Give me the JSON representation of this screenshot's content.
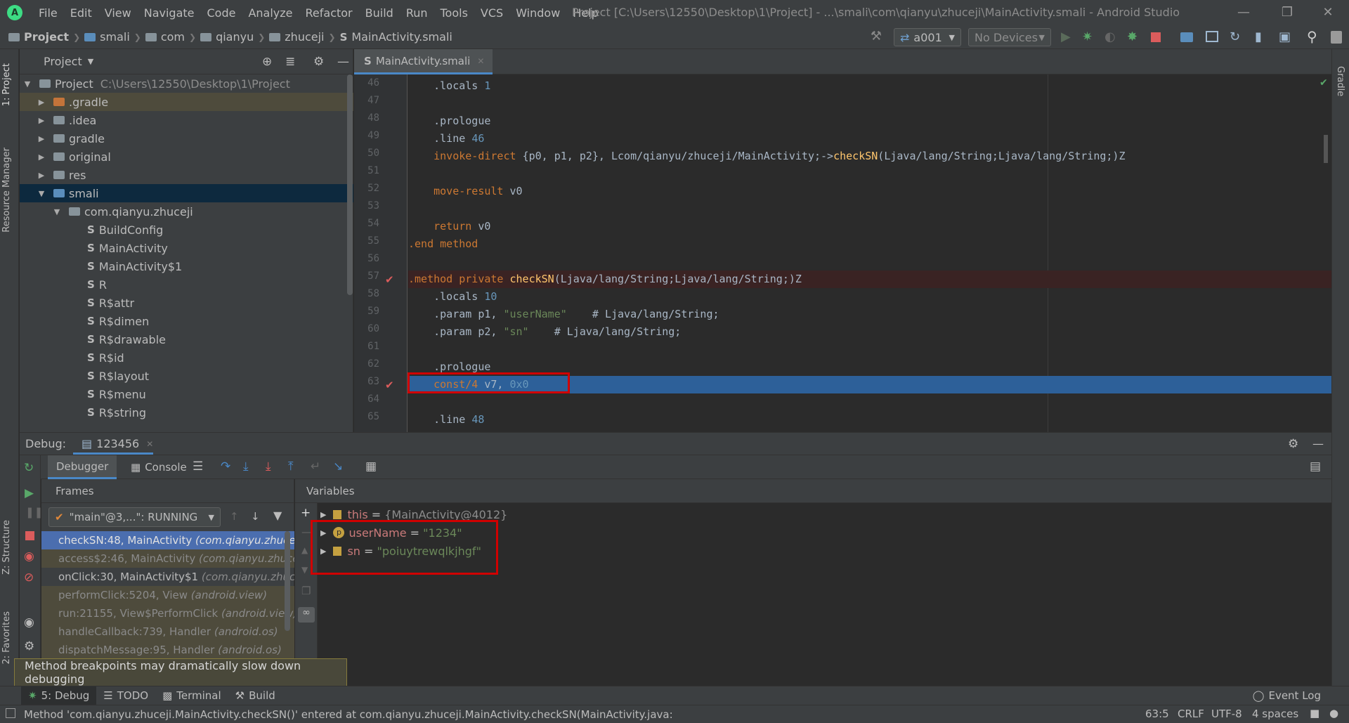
{
  "menubar": {
    "items": [
      "File",
      "Edit",
      "View",
      "Navigate",
      "Code",
      "Analyze",
      "Refactor",
      "Build",
      "Run",
      "Tools",
      "VCS",
      "Window",
      "Help"
    ],
    "window_title": "Project [C:\\Users\\12550\\Desktop\\1\\Project] - ...\\smali\\com\\qianyu\\zhuceji\\MainActivity.smali - Android Studio"
  },
  "navbar": {
    "crumbs": [
      "Project",
      "smali",
      "com",
      "qianyu",
      "zhuceji",
      "MainActivity.smali"
    ],
    "run_config": "a001",
    "device": "No Devices"
  },
  "left_stripe": {
    "project": "1: Project",
    "resource_manager": "Resource Manager",
    "structure": "Z: Structure",
    "favorites": "2: Favorites"
  },
  "right_stripe": {
    "gradle": "Gradle"
  },
  "project_panel": {
    "title": "Project",
    "tree": [
      {
        "label": "Project",
        "path": "C:\\Users\\12550\\Desktop\\1\\Project"
      },
      {
        "label": ".gradle"
      },
      {
        "label": ".idea"
      },
      {
        "label": "gradle"
      },
      {
        "label": "original"
      },
      {
        "label": "res"
      },
      {
        "label": "smali"
      },
      {
        "label": "com.qianyu.zhuceji"
      },
      {
        "label": "BuildConfig"
      },
      {
        "label": "MainActivity"
      },
      {
        "label": "MainActivity$1"
      },
      {
        "label": "R"
      },
      {
        "label": "R$attr"
      },
      {
        "label": "R$dimen"
      },
      {
        "label": "R$drawable"
      },
      {
        "label": "R$id"
      },
      {
        "label": "R$layout"
      },
      {
        "label": "R$menu"
      },
      {
        "label": "R$string"
      }
    ]
  },
  "editor": {
    "tab": "MainActivity.smali",
    "line_numbers": [
      "46",
      "47",
      "48",
      "49",
      "50",
      "51",
      "52",
      "53",
      "54",
      "55",
      "56",
      "57",
      "58",
      "59",
      "60",
      "61",
      "62",
      "63",
      "64",
      "65"
    ],
    "lines": {
      "l46a": ".locals",
      "l46b": "1",
      "l48": ".prologue",
      "l49a": ".line",
      "l49b": "46",
      "l50a": "invoke-direct",
      "l50b": "{p0, p1, p2},",
      "l50c": "Lcom/qianyu/zhuceji/MainActivity;->",
      "l50d": "checkSN",
      "l50e": "(Ljava/lang/String;Ljava/lang/String;)Z",
      "l52a": "move-result",
      "l52b": "v0",
      "l54a": "return",
      "l54b": "v0",
      "l55": ".end method",
      "l57a": ".method private",
      "l57b": "checkSN",
      "l57c": "(Ljava/lang/String;Ljava/lang/String;)Z",
      "l58a": ".locals",
      "l58b": "10",
      "l59a": ".param",
      "l59b": "p1,",
      "l59c": "\"userName\"",
      "l59d": "# Ljava/lang/String;",
      "l60a": ".param",
      "l60b": "p2,",
      "l60c": "\"sn\"",
      "l60d": "# Ljava/lang/String;",
      "l62": ".prologue",
      "l63a": "const/4",
      "l63b": "v7,",
      "l63c": "0x0",
      "l65a": ".line",
      "l65b": "48"
    }
  },
  "debug": {
    "label": "Debug:",
    "session": "123456",
    "tabs": {
      "debugger": "Debugger",
      "console": "Console"
    },
    "frames_title": "Frames",
    "thread": "\"main\"@3,...\": RUNNING",
    "frames": [
      {
        "method": "checkSN:48, MainActivity",
        "pkg": "(com.qianyu.zhuceji)"
      },
      {
        "method": "access$2:46, MainActivity",
        "pkg": "(com.qianyu.zhuceji)"
      },
      {
        "method": "onClick:30, MainActivity$1",
        "pkg": "(com.qianyu.zhuceji)"
      },
      {
        "method": "performClick:5204, View",
        "pkg": "(android.view)"
      },
      {
        "method": "run:21155, View$PerformClick",
        "pkg": "(android.view)"
      },
      {
        "method": "handleCallback:739, Handler",
        "pkg": "(android.os)"
      },
      {
        "method": "dispatchMessage:95, Handler",
        "pkg": "(android.os)"
      }
    ],
    "variables_title": "Variables",
    "variables": [
      {
        "name": "this",
        "value": "{MainActivity@4012}"
      },
      {
        "name": "userName",
        "value": "\"1234\""
      },
      {
        "name": "sn",
        "value": "\"poiuytrewqlkjhgf\""
      }
    ],
    "param_badge": "p"
  },
  "tooltip": "Method breakpoints may dramatically slow down debugging",
  "bottom_tabs": {
    "debug": "5: Debug",
    "todo": "TODO",
    "terminal": "Terminal",
    "build": "Build",
    "event_log": "Event Log"
  },
  "status": {
    "message": "Method 'com.qianyu.zhuceji.MainActivity.checkSN()' entered at com.qianyu.zhuceji.MainActivity.checkSN(MainActivity.java:",
    "position": "63:5",
    "line_sep": "CRLF",
    "encoding": "UTF-8",
    "indent": "4 spaces"
  }
}
